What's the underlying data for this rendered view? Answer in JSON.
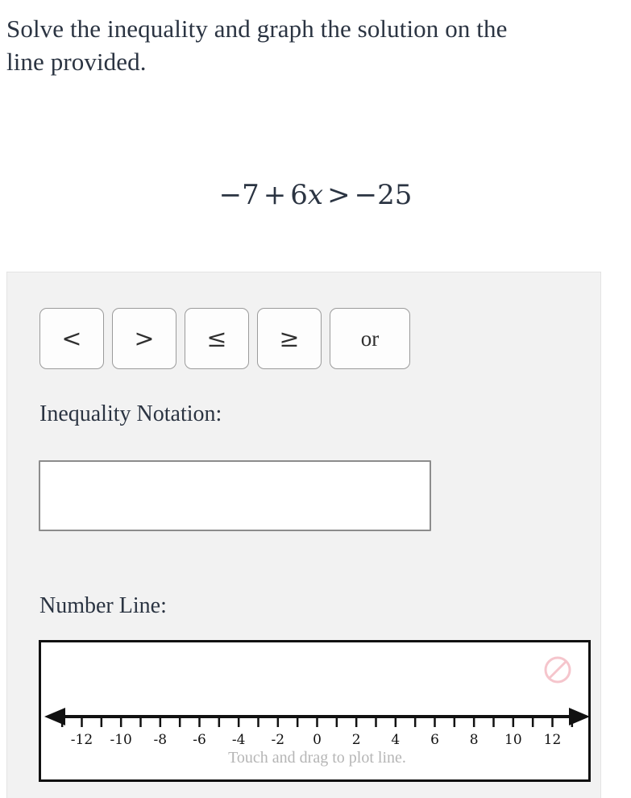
{
  "prompt": {
    "text": "Solve the inequality and graph the solution on the line provided."
  },
  "equation": {
    "plain": "-7 + 6x > -25",
    "lhs_const": "−7",
    "plus": "+",
    "coeff": "6",
    "variable": "x",
    "relation": ">",
    "rhs": "−25"
  },
  "answer_panel": {
    "operator_buttons": [
      {
        "label": "<",
        "name": "less-than"
      },
      {
        "label": ">",
        "name": "greater-than"
      },
      {
        "label": "≤",
        "name": "less-than-or-equal"
      },
      {
        "label": "≥",
        "name": "greater-than-or-equal"
      },
      {
        "label": "or",
        "name": "or"
      }
    ],
    "inequality_notation": {
      "label": "Inequality Notation:",
      "value": "",
      "placeholder": ""
    },
    "number_line": {
      "label": "Number Line:",
      "hint": "Touch and drag to plot line.",
      "clear_icon": "prohibition-icon",
      "clear_icon_color": "#f4bcc4"
    }
  },
  "chart_data": {
    "type": "number-line",
    "title": "Number Line:",
    "xlabel": "",
    "xlim": [
      -13.5,
      13.5
    ],
    "tick_step": 1,
    "label_step": 2,
    "tick_values": [
      -13,
      -12,
      -11,
      -10,
      -9,
      -8,
      -7,
      -6,
      -5,
      -4,
      -3,
      -2,
      -1,
      0,
      1,
      2,
      3,
      4,
      5,
      6,
      7,
      8,
      9,
      10,
      11,
      12,
      13
    ],
    "tick_labels": [
      {
        "value": -12,
        "text": "-12"
      },
      {
        "value": -10,
        "text": "-10"
      },
      {
        "value": -8,
        "text": "-8"
      },
      {
        "value": -6,
        "text": "-6"
      },
      {
        "value": -4,
        "text": "-4"
      },
      {
        "value": -2,
        "text": "-2"
      },
      {
        "value": 0,
        "text": "0"
      },
      {
        "value": 2,
        "text": "2"
      },
      {
        "value": 4,
        "text": "4"
      },
      {
        "value": 6,
        "text": "6"
      },
      {
        "value": 8,
        "text": "8"
      },
      {
        "value": 10,
        "text": "10"
      },
      {
        "value": 12,
        "text": "12"
      }
    ],
    "arrows": [
      "left",
      "right"
    ],
    "plotted_points": [],
    "plotted_rays": [],
    "axis_color": "#111111",
    "grid": false,
    "legend": null
  },
  "colors": {
    "page_background": "#ffffff",
    "panel_background": "#f2f2f2",
    "text": "#2b3442",
    "hint_text": "#b5b5b5",
    "button_border": "#9b9b9b",
    "input_border": "#8c8c8c",
    "axis": "#111111"
  }
}
